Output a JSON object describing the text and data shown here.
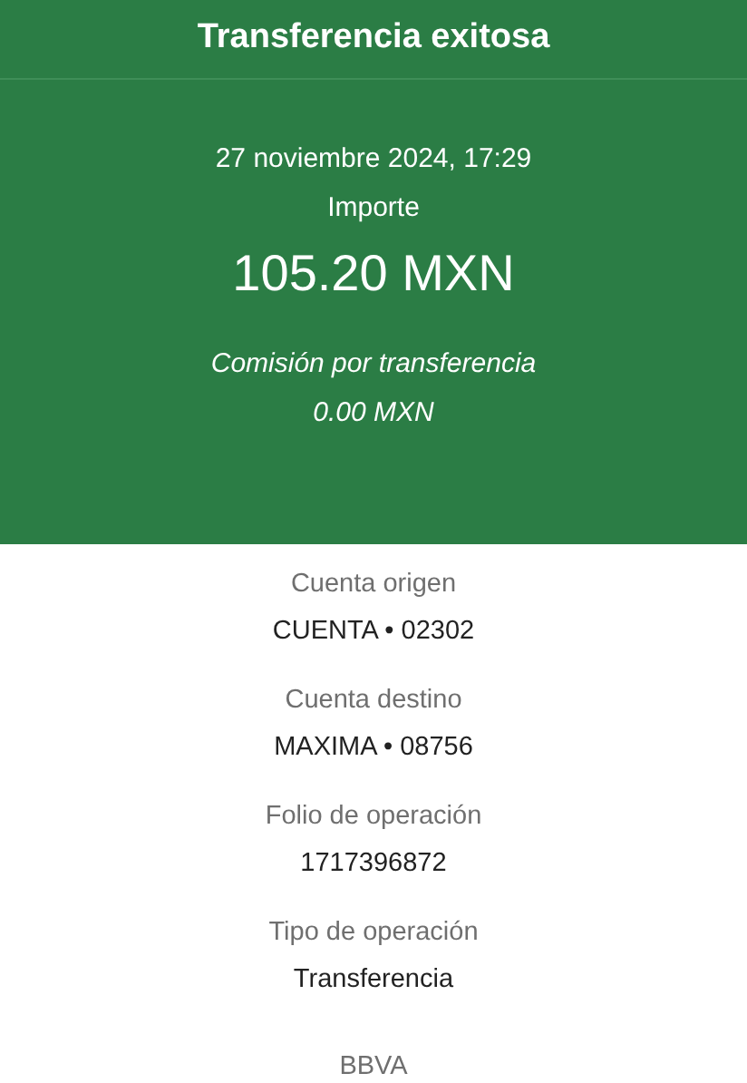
{
  "header": {
    "title": "Transferencia exitosa"
  },
  "summary": {
    "date": "27 noviembre 2024, 17:29",
    "amount_label": "Importe",
    "amount": "105.20 MXN",
    "fee_label": "Comisión por transferencia",
    "fee": "0.00 MXN"
  },
  "details": [
    {
      "label": "Cuenta origen",
      "value": "CUENTA • 02302"
    },
    {
      "label": "Cuenta destino",
      "value": "MAXIMA • 08756"
    },
    {
      "label": "Folio de operación",
      "value": "1717396872"
    },
    {
      "label": "Tipo de operación",
      "value": "Transferencia"
    }
  ],
  "footer": {
    "bank": "BBVA"
  }
}
